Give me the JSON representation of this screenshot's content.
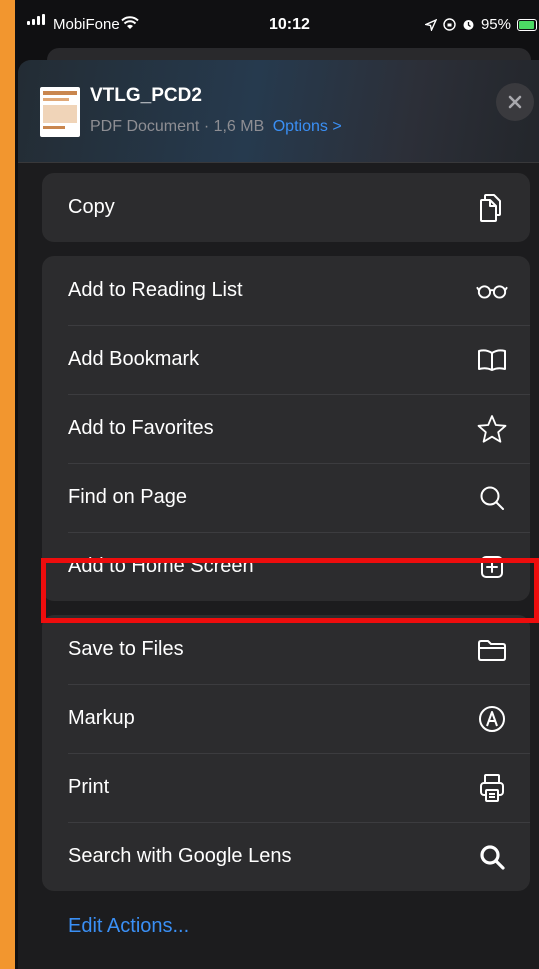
{
  "status_bar": {
    "carrier": "MobiFone",
    "time": "10:12",
    "battery_percent": "95%",
    "battery_level": 0.95,
    "icons": [
      "signal-icon",
      "wifi-icon",
      "location-icon",
      "screen-lock-icon",
      "alarm-icon",
      "battery-charging-icon"
    ]
  },
  "sheet": {
    "doc_title": "VTLG_PCD2",
    "doc_meta": "PDF Document · 1,6 MB",
    "options_label": "Options >",
    "close_icon": "close-icon"
  },
  "groups": [
    {
      "items": [
        {
          "label": "Copy",
          "icon": "copy-icon"
        }
      ]
    },
    {
      "items": [
        {
          "label": "Add to Reading List",
          "icon": "glasses-icon"
        },
        {
          "label": "Add Bookmark",
          "icon": "book-icon"
        },
        {
          "label": "Add to Favorites",
          "icon": "star-icon"
        },
        {
          "label": "Find on Page",
          "icon": "search-icon"
        },
        {
          "label": "Add to Home Screen",
          "icon": "plus-square-icon"
        }
      ]
    },
    {
      "items": [
        {
          "label": "Save to Files",
          "icon": "folder-icon"
        },
        {
          "label": "Markup",
          "icon": "markup-icon"
        },
        {
          "label": "Print",
          "icon": "printer-icon"
        },
        {
          "label": "Search with Google Lens",
          "icon": "search-bold-icon"
        }
      ]
    }
  ],
  "edit_actions_label": "Edit Actions...",
  "colors": {
    "accent": "#3a8ff5",
    "highlight": "#ee0d0d",
    "background": "#f2962f"
  }
}
